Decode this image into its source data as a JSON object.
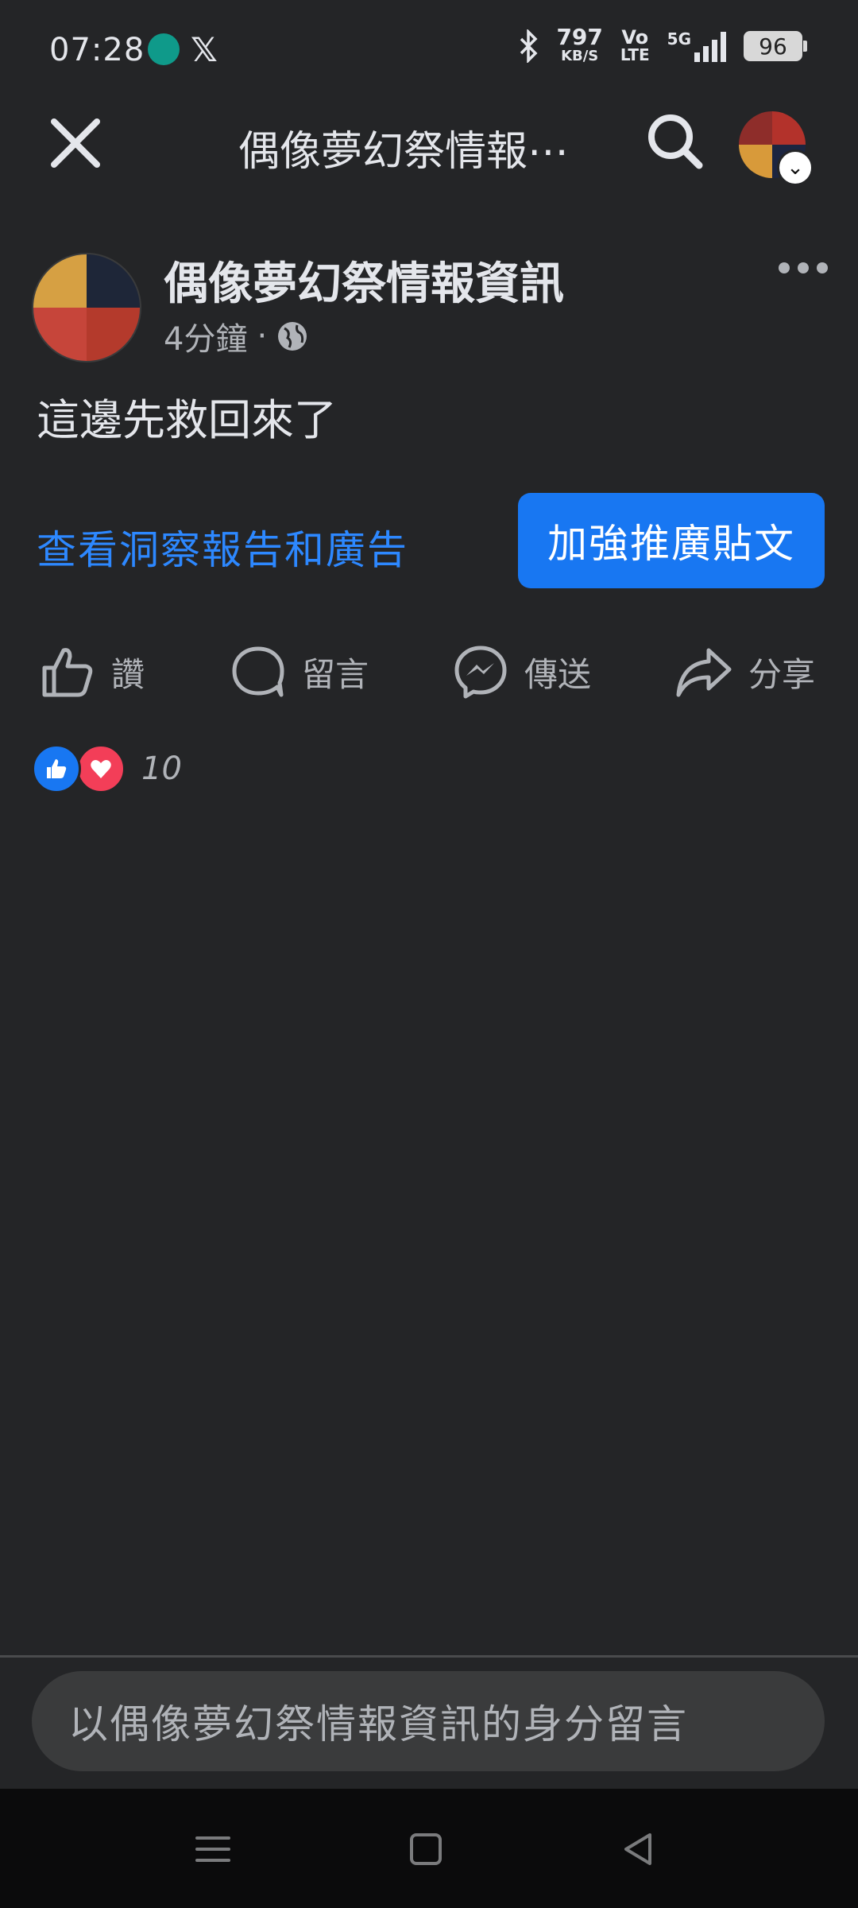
{
  "status_bar": {
    "time": "07:28",
    "net_speed_value": "797",
    "net_speed_unit": "KB/S",
    "volte_top": "Vo",
    "volte_bottom": "LTE",
    "network": "5G",
    "battery": "96"
  },
  "header": {
    "title": "偶像夢幻祭情報⋯",
    "icons": [
      "close-icon",
      "search-icon",
      "avatar",
      "chevron-down-icon"
    ]
  },
  "post": {
    "page_name": "偶像夢幻祭情報資訊",
    "time": "4分鐘",
    "separator": "·",
    "text": "這邊先救回來了",
    "insights_link": "查看洞察報告和廣告",
    "boost_button": "加強推廣貼文"
  },
  "actions": {
    "like": "讚",
    "comment": "留言",
    "send": "傳送",
    "share": "分享"
  },
  "reactions": {
    "count": "10",
    "types": [
      "like",
      "love"
    ]
  },
  "comment_bar": {
    "placeholder": "以偶像夢幻祭情報資訊的身分留言"
  },
  "colors": {
    "background": "#242527",
    "accent": "#1877f2",
    "link": "#2d88ff",
    "love": "#f33e58"
  }
}
